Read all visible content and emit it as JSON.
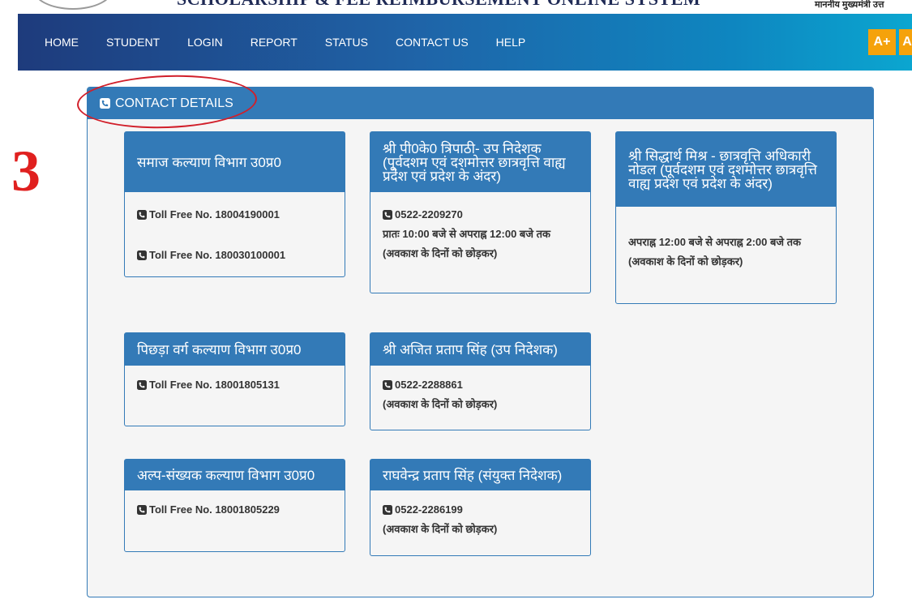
{
  "header": {
    "site_title": "SCHOLARSHIP & FEE REIMBURSEMENT ONLINE SYSTEM",
    "cm_caption": "माननीय मुख्यमंत्री उत्त"
  },
  "nav": {
    "items": [
      "HOME",
      "STUDENT",
      "LOGIN",
      "REPORT",
      "STATUS",
      "CONTACT US",
      "HELP"
    ],
    "font_increase": "A+",
    "font_normal": "A"
  },
  "annotation": {
    "step_number": "3"
  },
  "panel": {
    "title": "CONTACT DETAILS"
  },
  "cards": {
    "samaj": {
      "title": "समाज कल्याण विभाग उ0प्र0",
      "lines": [
        "Toll Free No. 18004190001",
        "Toll Free No. 180030100001"
      ]
    },
    "tripathi": {
      "title": "श्री पी0के0 त्रिपाठी- उप निदेशक (पूर्वदशम एवं दशमोत्तर छात्रवृत्ति वाह्य प्रदेश एवं प्रदेश के अंदर)",
      "phone": "0522-2209270",
      "timing": "प्रातः 10:00 बजे से अपराह्न 12:00 बजे तक",
      "note": "(अवकाश के दिनों को छोड़कर)"
    },
    "mishra": {
      "title": "श्री सिद्धार्थ मिश्र - छात्रवृत्ति अधिकारी नोडल (पूर्वदशम एवं दशमोत्तर छात्रवृत्ति वाह्य प्रदेश एवं प्रदेश के अंदर)",
      "timing": "अपराह्न 12:00 बजे से अपराह्न 2:00 बजे तक",
      "note": "(अवकाश के दिनों को छोड़कर)"
    },
    "pichhda": {
      "title": "पिछड़ा वर्ग कल्याण विभाग उ0प्र0",
      "line": "Toll Free No. 18001805131"
    },
    "ajit": {
      "title": "श्री अजित प्रताप सिंह (उप निदेशक)",
      "phone": "0522-2288861",
      "note": "(अवकाश के दिनों को छोड़कर)"
    },
    "alp": {
      "title": "अल्प-संख्यक कल्याण विभाग उ0प्र0",
      "line": "Toll Free No. 18001805229"
    },
    "raghvendra": {
      "title": "राघवेन्द्र प्रताप सिंह (संयुक्त निदेशक)",
      "phone": "0522-2286199",
      "note": "(अवकाश के दिनों को छोड़कर)"
    }
  },
  "colors": {
    "panel_blue": "#337ab7",
    "nav_gradient_start": "#1e3b7c",
    "nav_gradient_end": "#0ba6d0",
    "font_button": "#f5a20b",
    "annotation_red": "#d11f2a"
  },
  "icons": {
    "phone": "phone-square-icon"
  }
}
